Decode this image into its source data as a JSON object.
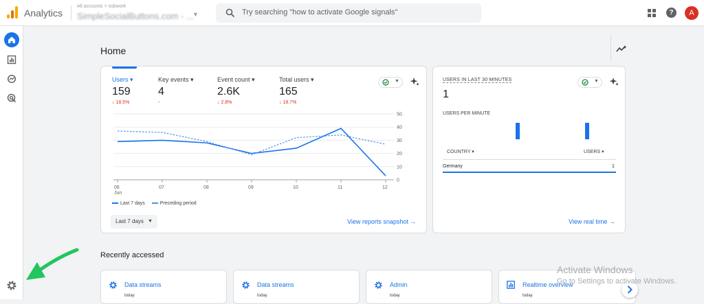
{
  "header": {
    "app_name": "Analytics",
    "account_small": "All accounts > ssbwork",
    "property_name": "SimpleSocialButtons.com - ...",
    "search_placeholder": "Try searching \"how to activate Google signals\"",
    "avatar_letter": "A"
  },
  "page": {
    "title": "Home"
  },
  "metrics": [
    {
      "label": "Users",
      "value": "159",
      "delta": "↓ 18.5%"
    },
    {
      "label": "Key events",
      "value": "4",
      "delta": "-"
    },
    {
      "label": "Event count",
      "value": "2.6K",
      "delta": "↓ 2.8%"
    },
    {
      "label": "Total users",
      "value": "165",
      "delta": "↓ 18.7%"
    }
  ],
  "chart_data": {
    "type": "line",
    "x": [
      "06",
      "07",
      "08",
      "09",
      "10",
      "11",
      "12"
    ],
    "x_sublabel": {
      "06": "Jun"
    },
    "yticks": [
      0,
      10,
      20,
      30,
      40,
      50
    ],
    "ylim": [
      0,
      50
    ],
    "grid": true,
    "series": [
      {
        "name": "Last 7 days",
        "style": "solid",
        "color": "#1a73e8",
        "values": [
          29,
          30,
          28,
          20,
          24,
          39,
          3
        ]
      },
      {
        "name": "Preceding period",
        "style": "dashed",
        "color": "#4a90e8",
        "values": [
          37,
          36,
          29,
          19,
          32,
          34,
          27
        ]
      }
    ]
  },
  "main_card": {
    "range_label": "Last 7 days",
    "snapshot_link": "View reports snapshot"
  },
  "realtime": {
    "title": "USERS IN LAST 30 MINUTES",
    "value": "1",
    "per_minute_label": "USERS PER MINUTE",
    "per_minute_bars": [
      0,
      0,
      0,
      0,
      0,
      0,
      1,
      0,
      0,
      0,
      0,
      0,
      1,
      0,
      0
    ],
    "col_country": "COUNTRY",
    "col_users": "USERS",
    "rows": [
      {
        "country": "Germany",
        "users": "1"
      }
    ],
    "realtime_link": "View real time"
  },
  "recent": {
    "title": "Recently accessed",
    "items": [
      {
        "label": "Data streams",
        "sub": "today",
        "icon": "gear-icon"
      },
      {
        "label": "Data streams",
        "sub": "today",
        "icon": "gear-icon"
      },
      {
        "label": "Admin",
        "sub": "today",
        "icon": "gear-icon"
      },
      {
        "label": "Realtime overview",
        "sub": "today",
        "icon": "report-icon"
      }
    ]
  },
  "watermark": {
    "line1": "Activate Windows",
    "line2": "Go to Settings to activate Windows."
  },
  "colors": {
    "accent": "#1a73e8",
    "negative": "#d93025",
    "logo": "#f9ab00",
    "arrow": "#22c55e"
  }
}
